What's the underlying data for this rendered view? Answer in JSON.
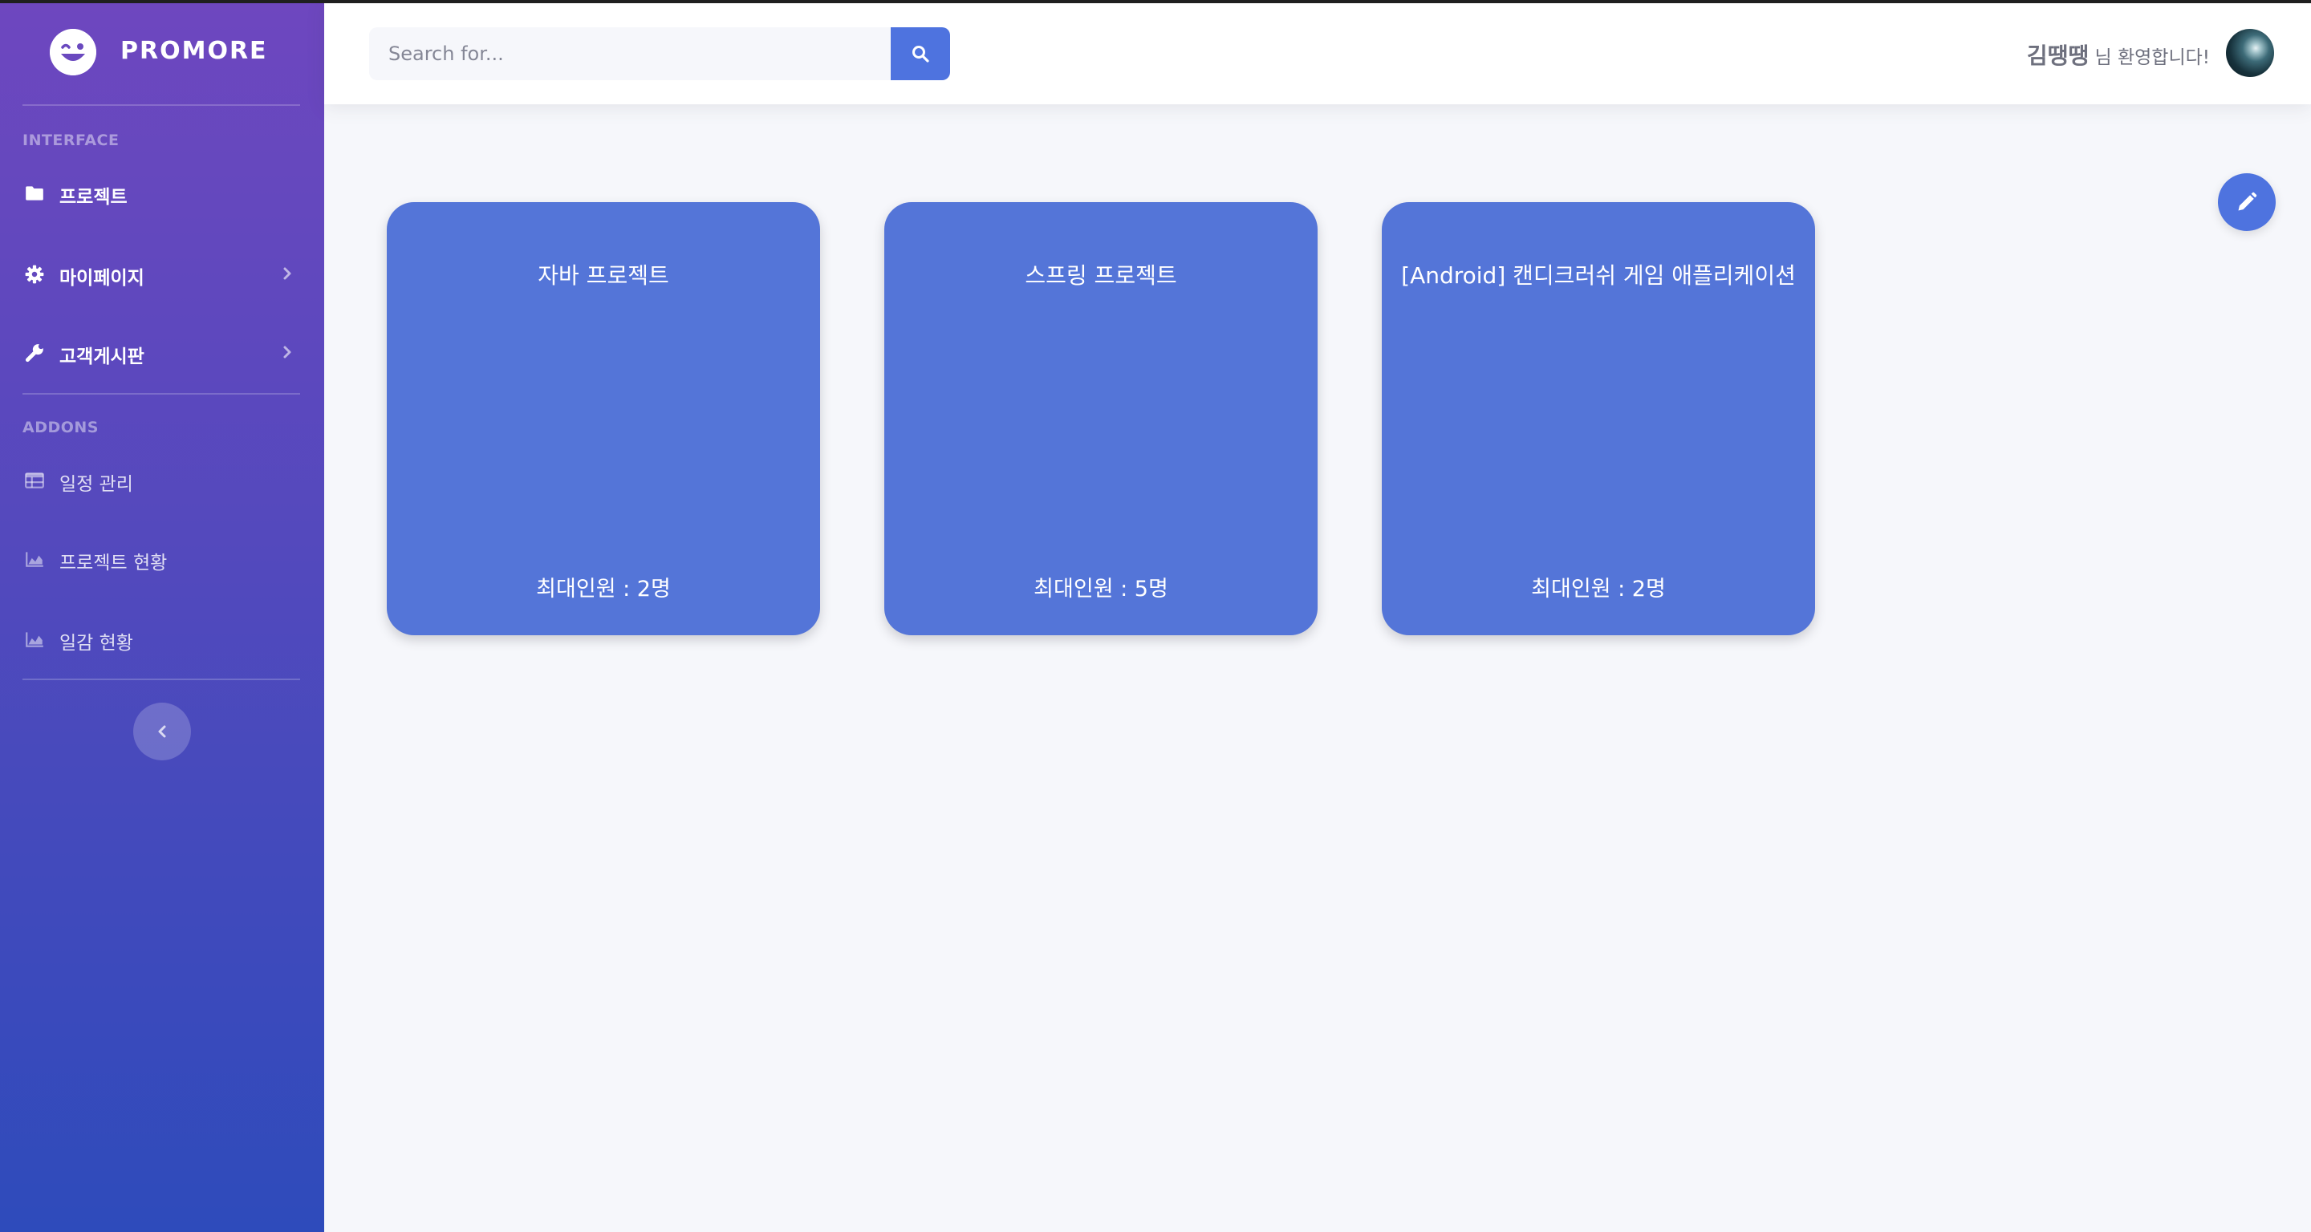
{
  "brand": {
    "name": "PROMORE",
    "logo_icon": "winking-face-icon"
  },
  "sidebar": {
    "sections": [
      "INTERFACE",
      "ADDONS"
    ],
    "items": [
      {
        "label": "프로젝트",
        "icon": "folder-icon",
        "has_submenu": false
      },
      {
        "label": "마이페이지",
        "icon": "gear-icon",
        "has_submenu": true
      },
      {
        "label": "고객게시판",
        "icon": "wrench-icon",
        "has_submenu": true
      },
      {
        "label": "일정 관리",
        "icon": "table-icon",
        "has_submenu": false
      },
      {
        "label": "프로젝트 현황",
        "icon": "area-chart-icon",
        "has_submenu": false
      },
      {
        "label": "일감 현황",
        "icon": "area-chart-icon",
        "has_submenu": false
      }
    ],
    "collapse_icon": "chevron-left-icon"
  },
  "topbar": {
    "search": {
      "placeholder": "Search for...",
      "value": ""
    },
    "user": {
      "name": "김땡땡",
      "greeting": "님 환영합니다!"
    }
  },
  "projects": [
    {
      "title": "자바 프로젝트",
      "members": "최대인원 : 2명"
    },
    {
      "title": "스프링 프로젝트",
      "members": "최대인원 : 5명"
    },
    {
      "title": "[Android] 캔디크러쉬 게임 애플리케이션",
      "members": "최대인원 : 2명"
    }
  ],
  "colors": {
    "primary": "#4e73df",
    "card": "#5475d8",
    "sidebar_top": "#6e47bf",
    "sidebar_bottom": "#2e4bbb",
    "background": "#f6f7fb"
  }
}
